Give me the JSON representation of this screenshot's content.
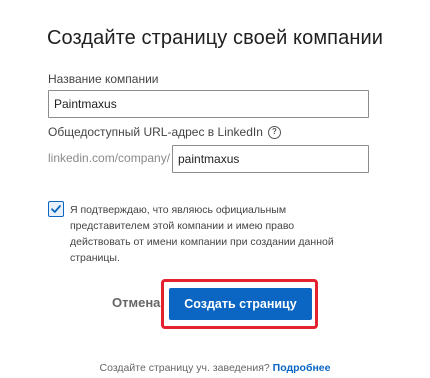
{
  "dialog": {
    "title": "Создайте страницу своей компании",
    "company_name_label": "Название компании",
    "company_name_value": "Paintmaxus",
    "url_label": "Общедоступный URL-адрес в LinkedIn",
    "url_prefix": "linkedin.com/company/",
    "url_value": "paintmaxus",
    "help_icon": "question-circle-icon",
    "consent_checked": true,
    "consent_text": "Я подтверждаю, что являюсь официальным представителем этой компании и имею право действовать от имени компании при создании данной страницы.",
    "cancel_label": "Отмена",
    "create_label": "Создать страницу",
    "footer_text": "Создайте страницу уч. заведения?",
    "footer_link": "Подробнее"
  },
  "colors": {
    "accent": "#0a66c2",
    "highlight": "#e3222d"
  }
}
